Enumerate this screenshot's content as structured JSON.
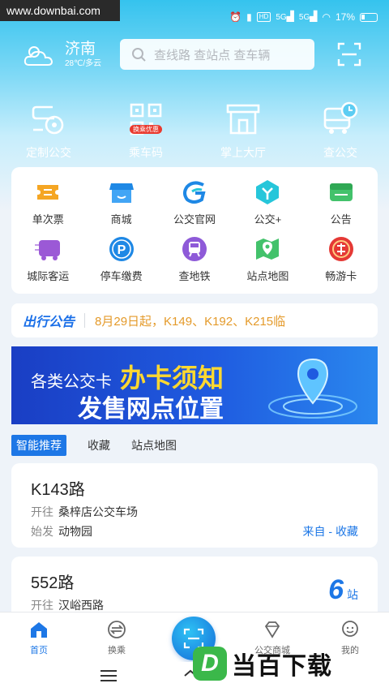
{
  "watermark": "www.downbai.com",
  "status": {
    "battery": "17%",
    "hd": "HD",
    "sig1": "5G",
    "sig2": "5G"
  },
  "header": {
    "city": "济南",
    "weather": "28℃/多云",
    "search_placeholder": "查线路 查站点 查车辆"
  },
  "quick": [
    {
      "label": "定制公交",
      "icon": "custom-bus-icon"
    },
    {
      "label": "乘车码",
      "icon": "qr-code-icon",
      "badge": "换乘优惠"
    },
    {
      "label": "掌上大厅",
      "icon": "hall-icon"
    },
    {
      "label": "查公交",
      "icon": "bus-clock-icon"
    }
  ],
  "grid": [
    {
      "label": "单次票",
      "icon": "ticket-icon"
    },
    {
      "label": "商城",
      "icon": "mall-icon"
    },
    {
      "label": "公交官网",
      "icon": "website-icon"
    },
    {
      "label": "公交+",
      "icon": "bus-plus-icon"
    },
    {
      "label": "公告",
      "icon": "notice-icon"
    },
    {
      "label": "城际客运",
      "icon": "intercity-icon"
    },
    {
      "label": "停车缴费",
      "icon": "parking-icon"
    },
    {
      "label": "查地铁",
      "icon": "metro-icon"
    },
    {
      "label": "站点地图",
      "icon": "map-icon"
    },
    {
      "label": "畅游卡",
      "icon": "travel-card-icon"
    }
  ],
  "notice": {
    "brand": "出行公告",
    "text": "8月29日起，K149、K192、K215临"
  },
  "banner": {
    "line1_prefix": "各类公交卡",
    "line1_big": "办卡须知",
    "line2": "发售网点位置"
  },
  "tabs": [
    "智能推荐",
    "收藏",
    "站点地图"
  ],
  "routes": [
    {
      "name": "K143路",
      "to_label": "开往",
      "to": "桑梓店公交车场",
      "from_label": "始发",
      "from": "动物园",
      "action": "来自 - 收藏"
    },
    {
      "name": "552路",
      "to_label": "开往",
      "to": "汉峪西路",
      "stops_num": "6",
      "stops_unit": "站"
    }
  ],
  "nav": [
    "首页",
    "换乘",
    "",
    "公交商城",
    "我的"
  ],
  "brand_watermark": {
    "letter": "D",
    "text": "当百下载"
  },
  "colors": {
    "accent": "#1d77e6",
    "notice_text": "#e49a2a",
    "banner_yellow": "#ffd830"
  }
}
